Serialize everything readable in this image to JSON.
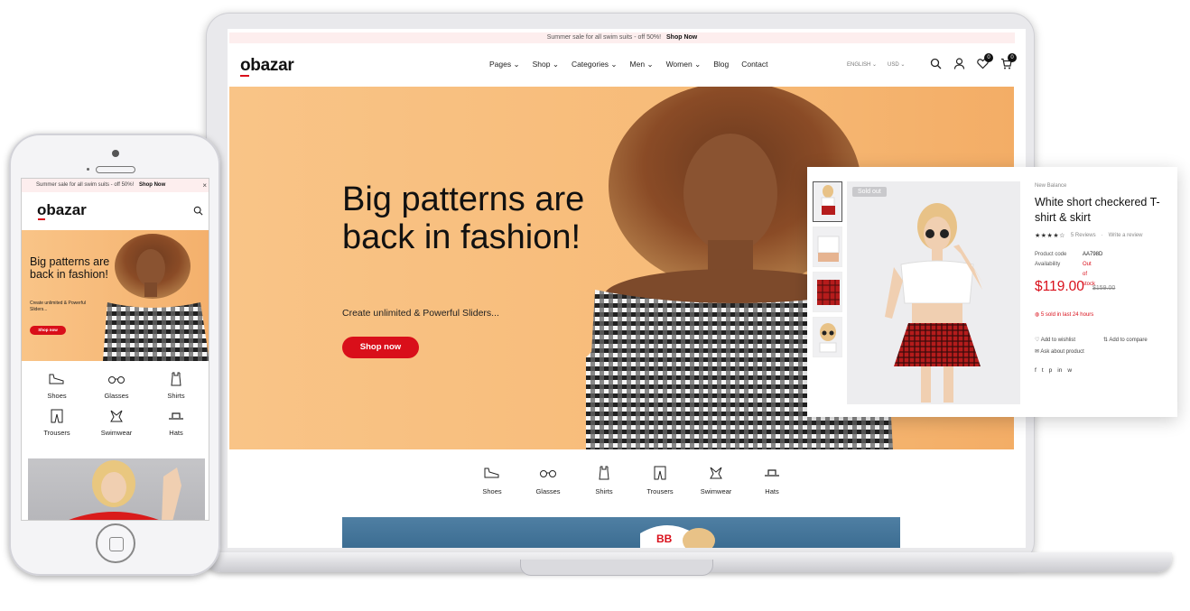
{
  "desktop": {
    "announcement": "Summer sale for all swim suits - off 50%!",
    "announcement_link": "Shop Now",
    "logo": "obazar",
    "nav": [
      "Pages",
      "Shop",
      "Categories",
      "Men",
      "Women",
      "Blog",
      "Contact"
    ],
    "language": "ENGLISH",
    "currency": "USD",
    "wishlist_count": "0",
    "cart_count": "0",
    "hero": {
      "title": "Big patterns are back in fashion!",
      "subtitle": "Create unlimited & Powerful Sliders...",
      "button": "Shop now"
    },
    "categories": [
      "Shoes",
      "Glasses",
      "Shirts",
      "Trousers",
      "Swimwear",
      "Hats"
    ]
  },
  "mobile": {
    "announcement": "Summer sale for all swim suits - off 50%!",
    "announcement_link": "Shop Now",
    "close": "×",
    "logo": "obazar",
    "hero": {
      "title": "Big patterns are back in fashion!",
      "subtitle": "Create unlimited & Powerful Sliders...",
      "button": "Shop now"
    },
    "categories": [
      "Shoes",
      "Glasses",
      "Shirts",
      "Trousers",
      "Swimwear",
      "Hats"
    ]
  },
  "product": {
    "sold_out": "Sold out",
    "brand": "New Balance",
    "title": "White short checkered T-shirt & skirt",
    "stars": "★★★★☆",
    "reviews": "5 Reviews",
    "write_review": "Write a review",
    "code_label": "Product code",
    "code_value": "AA798D",
    "availability_label": "Availability",
    "availability_value": "Out of stock",
    "price": "$119.00",
    "old_price": "$159.00",
    "sold_info": "5 sold in last 24 hours",
    "wishlist": "Add to wishlist",
    "compare": "Add to compare",
    "ask": "Ask about product",
    "social": [
      "f",
      "t",
      "p",
      "in",
      "w"
    ]
  },
  "colors": {
    "accent": "#d90f1a",
    "hero_bg": "#f8c07f",
    "announce_bg": "#fdeeee"
  }
}
